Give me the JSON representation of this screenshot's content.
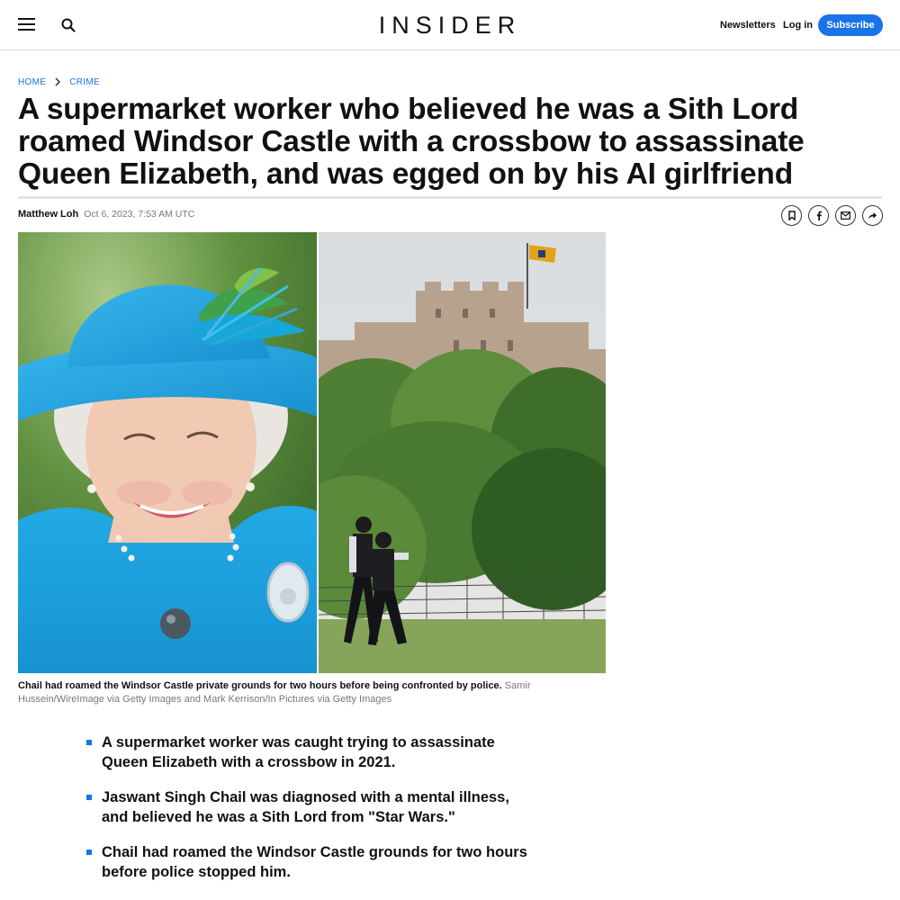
{
  "header": {
    "logo": "INSIDER",
    "newsletters_label": "Newsletters",
    "login_label": "Log in",
    "subscribe_label": "Subscribe",
    "menu_icon": "hamburger-menu-icon",
    "search_icon": "search-icon",
    "accent_color": "#1a73e8"
  },
  "breadcrumb": {
    "items": [
      "HOME",
      "CRIME"
    ]
  },
  "article": {
    "headline": "A supermarket worker who believed he was a Sith Lord roamed Windsor Castle with a crossbow to assassinate Queen Elizabeth, and was egged on by his AI girlfriend",
    "author": "Matthew Loh",
    "date": "Oct 6, 2023, 7:53 AM UTC",
    "share_icons": [
      "bookmark-icon",
      "facebook-icon",
      "email-icon",
      "share-arrow-icon"
    ],
    "caption": "Chail had roamed the Windsor Castle private grounds for two hours before being confronted by police.",
    "credit": "Samir Hussein/WireImage via Getty Images and Mark Kerrison/In Pictures via Getty Images",
    "key_points": [
      "A supermarket worker was caught trying to assassinate Queen Elizabeth with a crossbow in 2021.",
      "Jaswant Singh Chail was diagnosed with a mental illness, and believed he was a Sith Lord from \"Star Wars.\"",
      "Chail had roamed the Windsor Castle grounds for two hours before police stopped him."
    ]
  }
}
